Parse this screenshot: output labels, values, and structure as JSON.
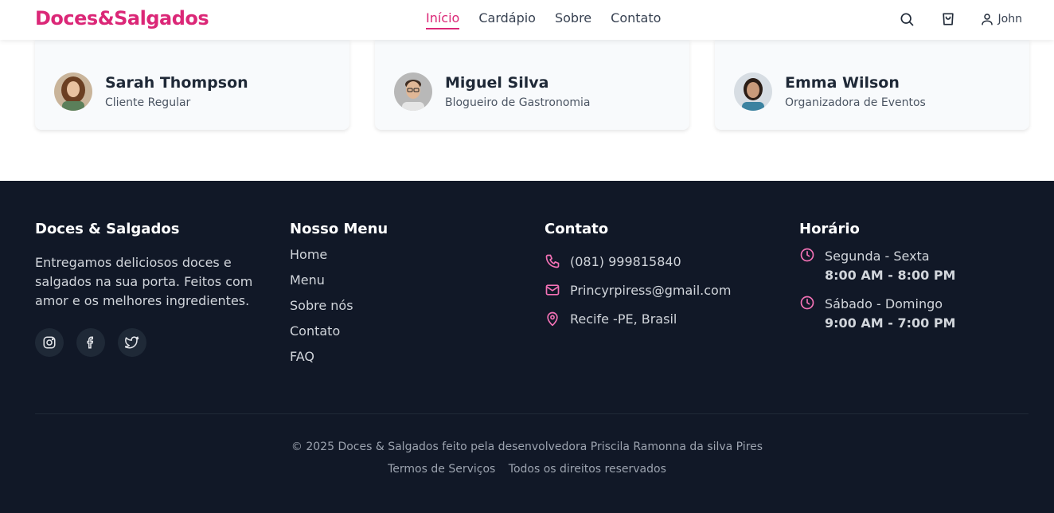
{
  "header": {
    "brand": "Doces&Salgados",
    "nav": [
      "Início",
      "Cardápio",
      "Sobre",
      "Contato"
    ],
    "user_name": "John"
  },
  "testimonials": [
    {
      "name": "Sarah Thompson",
      "role": "Cliente Regular"
    },
    {
      "name": "Miguel Silva",
      "role": "Blogueiro de Gastronomia"
    },
    {
      "name": "Emma Wilson",
      "role": "Organizadora de Eventos"
    }
  ],
  "footer": {
    "about": {
      "title": "Doces & Salgados",
      "description": "Entregamos deliciosos doces e salgados na sua porta. Feitos com amor e os melhores ingredientes."
    },
    "menu": {
      "title": "Nosso Menu",
      "links": [
        "Home",
        "Menu",
        "Sobre nós",
        "Contato",
        "FAQ"
      ]
    },
    "contact": {
      "title": "Contato",
      "phone": "(081) 999815840",
      "email": "Princyrpiress@gmail.com",
      "location": "Recife -PE, Brasil"
    },
    "hours": {
      "title": "Horário",
      "weekdays_label": "Segunda - Sexta",
      "weekdays_time": "8:00 AM - 8:00 PM",
      "weekend_label": "Sábado - Domingo",
      "weekend_time": "9:00 AM - 7:00 PM"
    },
    "copyright": "© 2025 Doces & Salgados feito pela desenvolvedora Priscila Ramonna da silva Pires",
    "terms": "Termos de Serviços",
    "rights": "Todos os direitos reservados"
  },
  "colors": {
    "accent": "#db2777",
    "footer_bg": "#111827",
    "icon_pink": "#f472b6"
  }
}
